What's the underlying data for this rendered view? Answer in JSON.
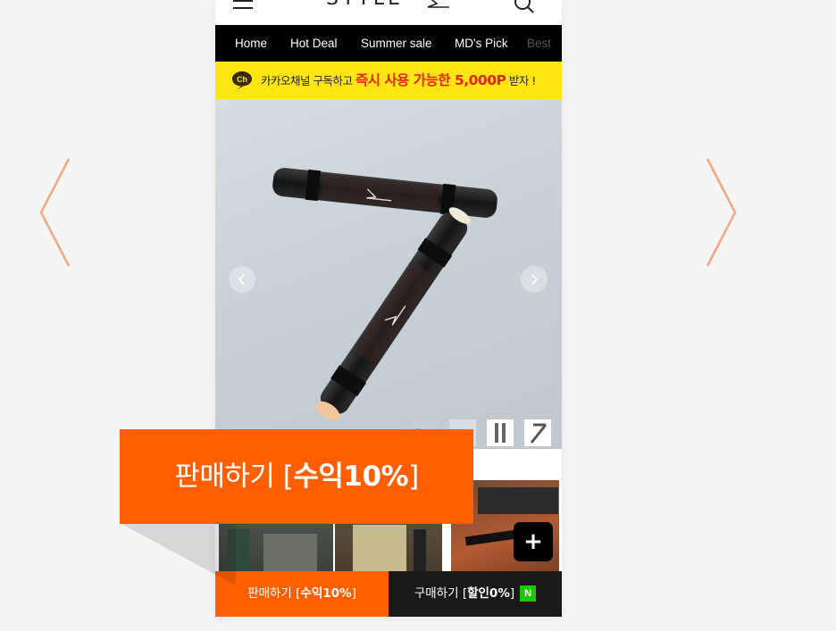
{
  "header": {
    "brand": "STYLE"
  },
  "nav": {
    "items": [
      "Home",
      "Hot Deal",
      "Summer sale",
      "MD's Pick",
      "Best"
    ]
  },
  "promo": {
    "badge": "Ch",
    "text_before": "카카오채널 구독하고 ",
    "highlight": "즉시 사용 가능한 5,000P",
    "text_after": " 받자 !"
  },
  "bottom_bar": {
    "sell_prefix": "판매하기 [",
    "sell_bold": "수익10%",
    "sell_suffix": "]",
    "buy_prefix": "구매하기 [",
    "buy_bold": "할인0%",
    "buy_suffix": "]",
    "naver_badge": "N"
  },
  "callout": {
    "prefix": "판매하기 [",
    "bold": "수익10%",
    "suffix": "]"
  },
  "plus_button": "+",
  "colors": {
    "accent": "#ff5f00",
    "nav_bg": "#000000",
    "promo_bg": "#ffe512",
    "promo_highlight": "#e8231e",
    "naver": "#1ec800",
    "outer_arrow": "#f4a77f"
  }
}
